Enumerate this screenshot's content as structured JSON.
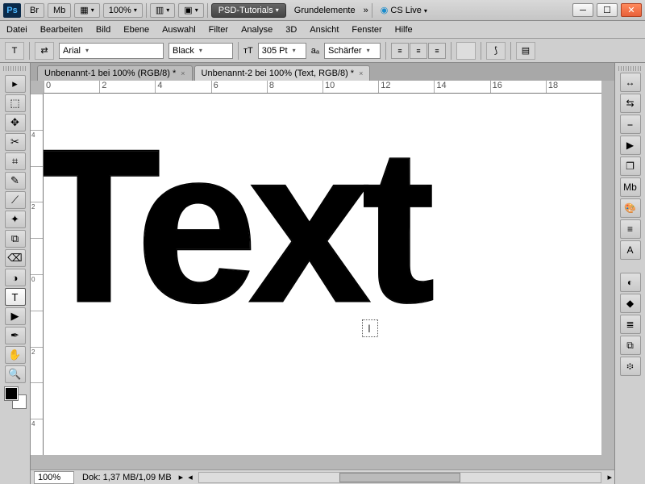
{
  "top": {
    "br": "Br",
    "mb": "Mb",
    "zoom": "100%",
    "wsA": "PSD-Tutorials",
    "wsB": "Grundelemente",
    "cs": "CS Live"
  },
  "menu": [
    "Datei",
    "Bearbeiten",
    "Bild",
    "Ebene",
    "Auswahl",
    "Filter",
    "Analyse",
    "3D",
    "Ansicht",
    "Fenster",
    "Hilfe"
  ],
  "opt": {
    "font": "Arial",
    "weight": "Black",
    "size": "305 Pt",
    "aa": "Schärfer"
  },
  "tabs": [
    {
      "label": "Unbenannt-1 bei 100% (RGB/8) *"
    },
    {
      "label": "Unbenannt-2 bei 100% (Text, RGB/8) *"
    }
  ],
  "canvas_text": "Text",
  "status": {
    "zoom": "100%",
    "doc": "Dok: 1,37 MB/1,09 MB"
  },
  "ruler_h": [
    "0",
    "2",
    "4",
    "6",
    "8",
    "10",
    "12",
    "14",
    "16",
    "18"
  ],
  "ruler_v": [
    "",
    "4",
    "",
    "2",
    "",
    "0",
    "",
    "2",
    "",
    "4"
  ],
  "tools": [
    "▸",
    "⬚",
    "✥",
    "✂",
    "⌗",
    "✎",
    "⟋",
    "✦",
    "⧉",
    "⌫",
    "◑",
    "T",
    "▶",
    "✒",
    "✋",
    "🔍"
  ],
  "rp_top": [
    "↔",
    "⇆",
    "⎯",
    "▶",
    "❐",
    "Mb",
    "🎨",
    "≡",
    "A"
  ],
  "rp_bot": [
    "◐",
    "◆",
    "≣",
    "⧉",
    "፨"
  ]
}
